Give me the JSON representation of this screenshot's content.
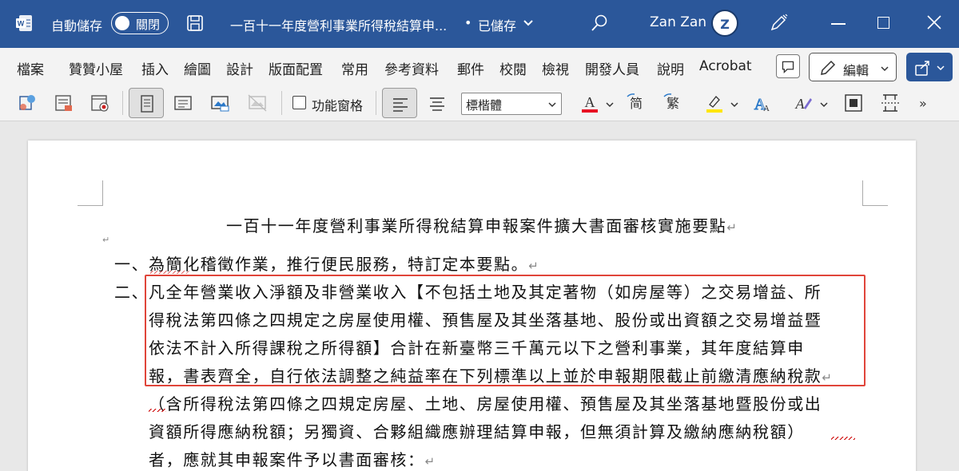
{
  "titlebar": {
    "autosave_label": "自動儲存",
    "autosave_state": "關閉",
    "doc_title": "一百十一年度營利事業所得稅結算申...",
    "separator": "•",
    "save_status": "已儲存",
    "user_name": "Zan Zan",
    "avatar_text": "Z"
  },
  "menu": {
    "items": [
      "檔案",
      "贊贊小屋",
      "插入",
      "繪圖",
      "設計",
      "版面配置",
      "常用",
      "參考資料",
      "郵件",
      "校閱",
      "檢視",
      "開發人員",
      "說明",
      "Acrobat"
    ],
    "edit_label": "編輯"
  },
  "ribbon": {
    "nav_pane_label": "功能窗格",
    "font_name": "標楷體",
    "more": "»"
  },
  "document": {
    "title": "一百十一年度營利事業所得稅結算申報案件擴大書面審核實施要點",
    "item1_num": "一、",
    "item1_text": "為簡化稽徵作業，推行便民服務，特訂定本要點。",
    "item2_num": "二、",
    "item2_lines": [
      "凡全年營業收入淨額及非營業收入【不包括土地及其定著物（如房屋等）之交易增益、所",
      "得稅法第四條之四規定之房屋使用權、預售屋及其坐落基地、股份或出資額之交易增益暨",
      "依法不計入所得課稅之所得額】合計在新臺幣三千萬元以下之營利事業，其年度結算申",
      "報，書表齊全，自行依法調整之純益率在下列標準以上並於申報期限截止前繳清應納稅款",
      "（含所得稅法第四條之四規定房屋、土地、房屋使用權、預售屋及其坐落基地暨股份或出",
      "資額所得應納稅額；另獨資、合夥組織應辦理結算申報，但無須計算及繳納應納稅額）",
      "者，應就其申報案件予以書面審核："
    ],
    "para_mark": "↵"
  },
  "colors": {
    "titlebar_bg": "#2b579a",
    "highlight_border": "#e0453a",
    "font_color_red": "#e81123",
    "highlight_yellow": "#ffe600"
  }
}
